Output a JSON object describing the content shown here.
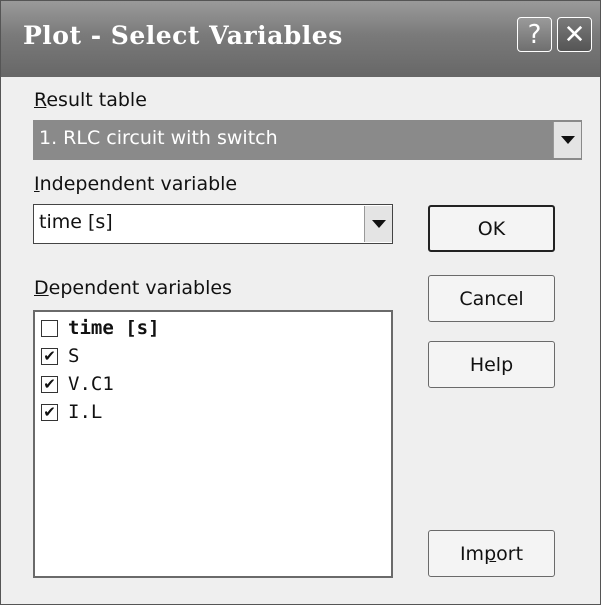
{
  "window": {
    "title": "Plot - Select Variables",
    "help_glyph": "?",
    "close_glyph": "✕"
  },
  "result_table": {
    "label_ul": "R",
    "label_rest": "esult table",
    "value": "1. RLC circuit with switch"
  },
  "independent": {
    "label_ul": "I",
    "label_rest": "ndependent variable",
    "value": "time [s]"
  },
  "dependent": {
    "label_ul": "D",
    "label_rest": "ependent variables",
    "items": [
      {
        "label": "time [s]",
        "checked": false,
        "bold": true
      },
      {
        "label": "S",
        "checked": true,
        "bold": false
      },
      {
        "label": "V.C1",
        "checked": true,
        "bold": false
      },
      {
        "label": "I.L",
        "checked": true,
        "bold": false
      }
    ]
  },
  "buttons": {
    "ok": "OK",
    "cancel": "Cancel",
    "help": "Help",
    "import_pre": "Im",
    "import_ul": "p",
    "import_post": "ort"
  },
  "icons": {
    "help": "question-icon",
    "close": "close-icon",
    "dropdown": "chevron-down-icon",
    "check": "checkmark-icon"
  }
}
